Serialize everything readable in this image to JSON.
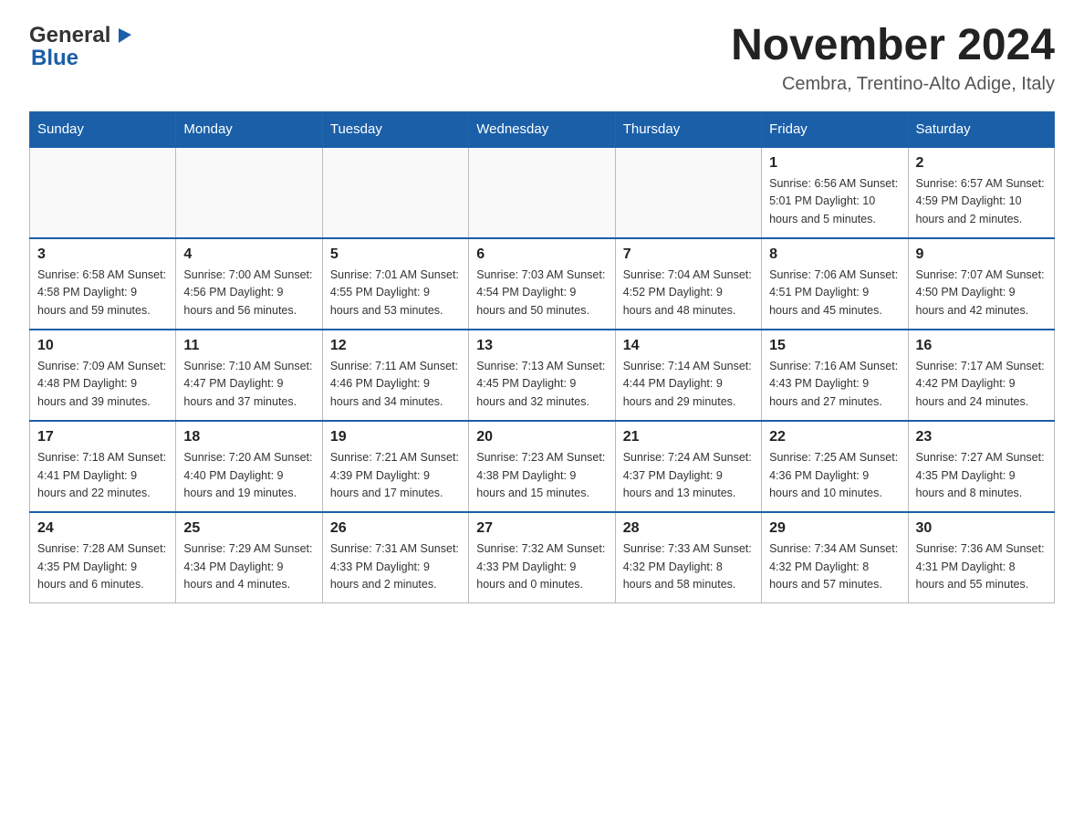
{
  "header": {
    "logo_general": "General",
    "logo_blue": "Blue",
    "title": "November 2024",
    "subtitle": "Cembra, Trentino-Alto Adige, Italy"
  },
  "calendar": {
    "days_of_week": [
      "Sunday",
      "Monday",
      "Tuesday",
      "Wednesday",
      "Thursday",
      "Friday",
      "Saturday"
    ],
    "weeks": [
      [
        {
          "day": "",
          "detail": ""
        },
        {
          "day": "",
          "detail": ""
        },
        {
          "day": "",
          "detail": ""
        },
        {
          "day": "",
          "detail": ""
        },
        {
          "day": "",
          "detail": ""
        },
        {
          "day": "1",
          "detail": "Sunrise: 6:56 AM\nSunset: 5:01 PM\nDaylight: 10 hours\nand 5 minutes."
        },
        {
          "day": "2",
          "detail": "Sunrise: 6:57 AM\nSunset: 4:59 PM\nDaylight: 10 hours\nand 2 minutes."
        }
      ],
      [
        {
          "day": "3",
          "detail": "Sunrise: 6:58 AM\nSunset: 4:58 PM\nDaylight: 9 hours\nand 59 minutes."
        },
        {
          "day": "4",
          "detail": "Sunrise: 7:00 AM\nSunset: 4:56 PM\nDaylight: 9 hours\nand 56 minutes."
        },
        {
          "day": "5",
          "detail": "Sunrise: 7:01 AM\nSunset: 4:55 PM\nDaylight: 9 hours\nand 53 minutes."
        },
        {
          "day": "6",
          "detail": "Sunrise: 7:03 AM\nSunset: 4:54 PM\nDaylight: 9 hours\nand 50 minutes."
        },
        {
          "day": "7",
          "detail": "Sunrise: 7:04 AM\nSunset: 4:52 PM\nDaylight: 9 hours\nand 48 minutes."
        },
        {
          "day": "8",
          "detail": "Sunrise: 7:06 AM\nSunset: 4:51 PM\nDaylight: 9 hours\nand 45 minutes."
        },
        {
          "day": "9",
          "detail": "Sunrise: 7:07 AM\nSunset: 4:50 PM\nDaylight: 9 hours\nand 42 minutes."
        }
      ],
      [
        {
          "day": "10",
          "detail": "Sunrise: 7:09 AM\nSunset: 4:48 PM\nDaylight: 9 hours\nand 39 minutes."
        },
        {
          "day": "11",
          "detail": "Sunrise: 7:10 AM\nSunset: 4:47 PM\nDaylight: 9 hours\nand 37 minutes."
        },
        {
          "day": "12",
          "detail": "Sunrise: 7:11 AM\nSunset: 4:46 PM\nDaylight: 9 hours\nand 34 minutes."
        },
        {
          "day": "13",
          "detail": "Sunrise: 7:13 AM\nSunset: 4:45 PM\nDaylight: 9 hours\nand 32 minutes."
        },
        {
          "day": "14",
          "detail": "Sunrise: 7:14 AM\nSunset: 4:44 PM\nDaylight: 9 hours\nand 29 minutes."
        },
        {
          "day": "15",
          "detail": "Sunrise: 7:16 AM\nSunset: 4:43 PM\nDaylight: 9 hours\nand 27 minutes."
        },
        {
          "day": "16",
          "detail": "Sunrise: 7:17 AM\nSunset: 4:42 PM\nDaylight: 9 hours\nand 24 minutes."
        }
      ],
      [
        {
          "day": "17",
          "detail": "Sunrise: 7:18 AM\nSunset: 4:41 PM\nDaylight: 9 hours\nand 22 minutes."
        },
        {
          "day": "18",
          "detail": "Sunrise: 7:20 AM\nSunset: 4:40 PM\nDaylight: 9 hours\nand 19 minutes."
        },
        {
          "day": "19",
          "detail": "Sunrise: 7:21 AM\nSunset: 4:39 PM\nDaylight: 9 hours\nand 17 minutes."
        },
        {
          "day": "20",
          "detail": "Sunrise: 7:23 AM\nSunset: 4:38 PM\nDaylight: 9 hours\nand 15 minutes."
        },
        {
          "day": "21",
          "detail": "Sunrise: 7:24 AM\nSunset: 4:37 PM\nDaylight: 9 hours\nand 13 minutes."
        },
        {
          "day": "22",
          "detail": "Sunrise: 7:25 AM\nSunset: 4:36 PM\nDaylight: 9 hours\nand 10 minutes."
        },
        {
          "day": "23",
          "detail": "Sunrise: 7:27 AM\nSunset: 4:35 PM\nDaylight: 9 hours\nand 8 minutes."
        }
      ],
      [
        {
          "day": "24",
          "detail": "Sunrise: 7:28 AM\nSunset: 4:35 PM\nDaylight: 9 hours\nand 6 minutes."
        },
        {
          "day": "25",
          "detail": "Sunrise: 7:29 AM\nSunset: 4:34 PM\nDaylight: 9 hours\nand 4 minutes."
        },
        {
          "day": "26",
          "detail": "Sunrise: 7:31 AM\nSunset: 4:33 PM\nDaylight: 9 hours\nand 2 minutes."
        },
        {
          "day": "27",
          "detail": "Sunrise: 7:32 AM\nSunset: 4:33 PM\nDaylight: 9 hours\nand 0 minutes."
        },
        {
          "day": "28",
          "detail": "Sunrise: 7:33 AM\nSunset: 4:32 PM\nDaylight: 8 hours\nand 58 minutes."
        },
        {
          "day": "29",
          "detail": "Sunrise: 7:34 AM\nSunset: 4:32 PM\nDaylight: 8 hours\nand 57 minutes."
        },
        {
          "day": "30",
          "detail": "Sunrise: 7:36 AM\nSunset: 4:31 PM\nDaylight: 8 hours\nand 55 minutes."
        }
      ]
    ]
  }
}
